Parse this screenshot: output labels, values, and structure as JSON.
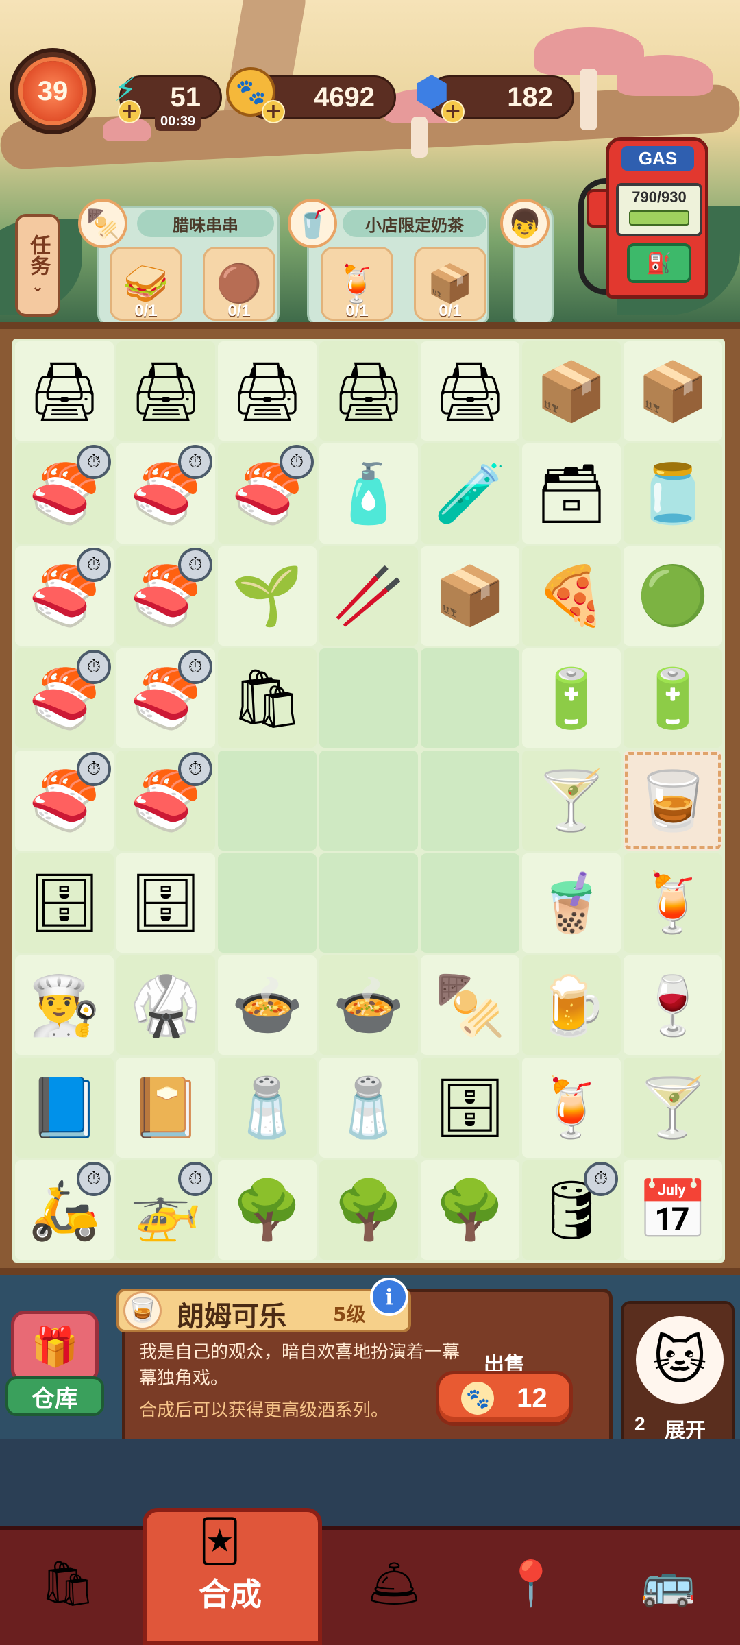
{
  "header": {
    "level": "39",
    "energy": {
      "value": "51",
      "timer": "00:39",
      "icon": "lightning-icon"
    },
    "coins": {
      "value": "4692",
      "icon": "paw-coin-icon"
    },
    "gems": {
      "value": "182",
      "icon": "gem-icon"
    }
  },
  "tasks": {
    "label": "任务",
    "orders": [
      {
        "title": "腊味串串",
        "items": [
          {
            "count": "0/1",
            "icon": "toast-icon"
          },
          {
            "count": "0/1",
            "icon": "meatball-icon"
          }
        ]
      },
      {
        "title": "小店限定奶茶",
        "items": [
          {
            "count": "0/1",
            "icon": "milk-tea-icon"
          },
          {
            "count": "0/1",
            "icon": "box-icon"
          }
        ]
      }
    ]
  },
  "gas": {
    "label": "GAS",
    "value": "790/930",
    "fill": 0.85
  },
  "board": {
    "rows": [
      [
        "printer",
        "printer",
        "printer",
        "printer",
        "printer",
        "skewer-box",
        "skewer-box"
      ],
      [
        "seaweed-roll",
        "seaweed-roll",
        "seaweed-roll",
        "ink-bottle",
        "ink-bottles",
        "ink-cartridge",
        "ink-jar"
      ],
      [
        "seaweed-roll",
        "seaweed-roll",
        "sprout-roll",
        "small-roll",
        "paper-box",
        "meat-pizza",
        "green-tape"
      ],
      [
        "seaweed-roll",
        "seaweed-roll",
        "paper-bag",
        "empty",
        "empty",
        "battery",
        "battery"
      ],
      [
        "seaweed-roll",
        "seaweed-roll",
        "empty",
        "empty",
        "empty",
        "lime-drink",
        "rum-cola"
      ],
      [
        "safe-box",
        "cabinet",
        "empty",
        "empty",
        "empty",
        "iced-tea",
        "berry-drink"
      ],
      [
        "chef-hat",
        "chef-uniform",
        "hot-pot",
        "hot-pot",
        "skewer-stand",
        "mule-mug",
        "red-cocktail"
      ],
      [
        "notebook",
        "bear-notebook",
        "spice-rack",
        "spice-rack",
        "shelf",
        "sunrise-cocktail",
        "margarita"
      ],
      [
        "scooter",
        "drone-package",
        "tree",
        "tree",
        "tree",
        "keg",
        "calendar"
      ]
    ]
  },
  "info": {
    "name": "朗姆可乐",
    "level": "5级",
    "description": "我是自己的观众，暗自欢喜地扮演着一幕幕独角戏。",
    "hint": "合成后可以获得更高级酒系列。",
    "sell_label": "出售",
    "sell_price": "12"
  },
  "warehouse": {
    "label": "仓库"
  },
  "cat": {
    "count": "2",
    "expand": "展开"
  },
  "nav": {
    "active_label": "合成",
    "items": [
      "shopping-bag-icon",
      "merge-cards-icon",
      "service-bell-icon",
      "map-pin-icon",
      "bus-icon"
    ]
  }
}
